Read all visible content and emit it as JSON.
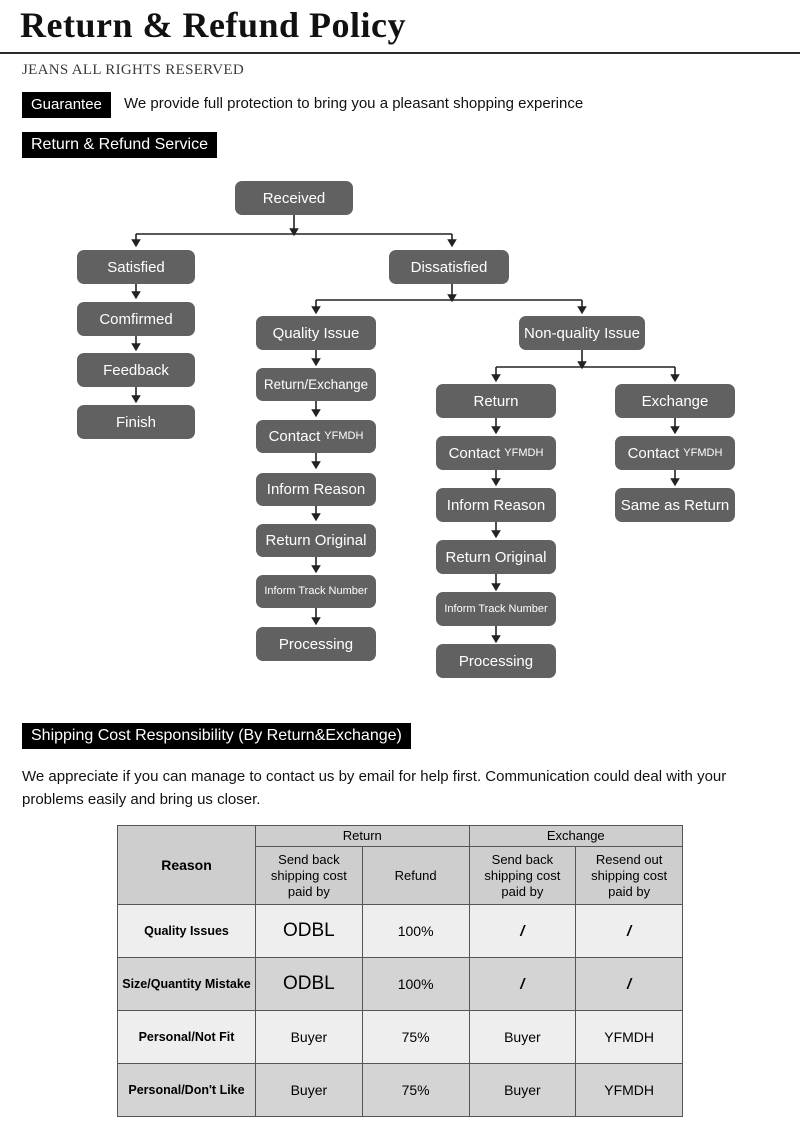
{
  "header": {
    "title": "Return & Refund Policy",
    "rights": "JEANS ALL RIGHTS RESERVED",
    "guarantee_tag": "Guarantee",
    "guarantee_text": "We provide full protection to bring you a pleasant shopping experince",
    "service_tag": "Return & Refund Service"
  },
  "flow": {
    "root": "Received",
    "satisfied": [
      "Satisfied",
      "Comfirmed",
      "Feedback",
      "Finish"
    ],
    "dissatisfied": "Dissatisfied",
    "quality": {
      "head": "Quality Issue",
      "steps_1": "Return/Exchange",
      "contact_main": "Contact",
      "contact_sub": "YFMDH",
      "steps_2": "Inform Reason",
      "steps_3": "Return Original",
      "steps_4": "Inform Track Number",
      "steps_5": "Processing"
    },
    "nonquality": {
      "head": "Non-quality Issue",
      "return_head": "Return",
      "exchange_head": "Exchange",
      "contact_main": "Contact",
      "contact_sub": "YFMDH",
      "inform_reason": "Inform Reason",
      "return_original": "Return Original",
      "inform_track": "Inform Track Number",
      "processing": "Processing",
      "same_as_return": "Same as Return"
    }
  },
  "shipping": {
    "tag": "Shipping Cost Responsibility (By Return&Exchange)",
    "paragraph": "We appreciate if you can manage to contact us by email for help first. Communication could deal with your problems easily and bring us closer."
  },
  "table": {
    "group_headers": {
      "reason": "Reason",
      "return": "Return",
      "exchange": "Exchange"
    },
    "sub_headers": {
      "return_send_back": "Send back shipping cost paid by",
      "refund": "Refund",
      "exchange_send_back": "Send back shipping cost paid by",
      "exchange_resend": "Resend out shipping cost paid by"
    },
    "rows": [
      {
        "reason": "Quality Issues",
        "return_send_back": "ODBL",
        "refund": "100%",
        "exchange_send_back": "/",
        "exchange_resend": "/"
      },
      {
        "reason": "Size/Quantity Mistake",
        "return_send_back": "ODBL",
        "refund": "100%",
        "exchange_send_back": "/",
        "exchange_resend": "/"
      },
      {
        "reason": "Personal/Not Fit",
        "return_send_back": "Buyer",
        "refund": "75%",
        "exchange_send_back": "Buyer",
        "exchange_resend": "YFMDH"
      },
      {
        "reason": "Personal/Don't Like",
        "return_send_back": "Buyer",
        "refund": "75%",
        "exchange_send_back": "Buyer",
        "exchange_resend": "YFMDH"
      }
    ]
  },
  "colors": {
    "node_fill": "#616161",
    "tag_bg": "#000000",
    "header_row": "#cecece",
    "row_light": "#eeeeee",
    "row_dark": "#d4d4d4",
    "connector": "#222222"
  }
}
